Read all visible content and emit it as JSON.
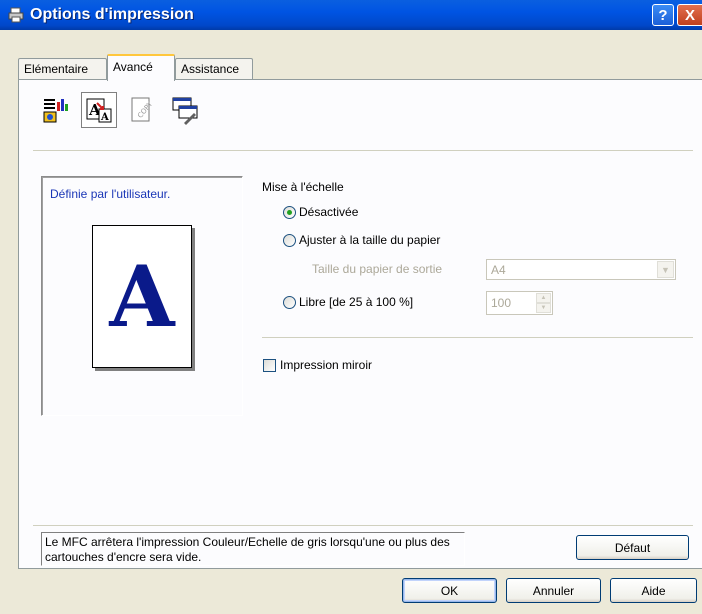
{
  "window": {
    "title": "Options d'impression",
    "help_btn": "?",
    "close_btn": "X"
  },
  "tabs": [
    {
      "label": "Elémentaire",
      "selected": false
    },
    {
      "label": "Avancé",
      "selected": true
    },
    {
      "label": "Assistance",
      "selected": false
    }
  ],
  "toolbar": {
    "icons": [
      "print-quality-icon",
      "scaling-icon",
      "watermark-copy-icon",
      "device-options-icon"
    ],
    "selected": "scaling-icon"
  },
  "preview": {
    "label": "Définie par l'utilisateur.",
    "letter": "A"
  },
  "scaling": {
    "group_label": "Mise à l'échelle",
    "option_off": "Désactivée",
    "option_fit": "Ajuster à la taille du papier",
    "output_paper_label": "Taille du papier de sortie",
    "output_paper_value": "A4",
    "option_free": "Libre [de 25 à 100 %]",
    "free_value": "100",
    "selected": "option_off"
  },
  "mirror": {
    "label": "Impression miroir",
    "checked": false
  },
  "info_text": "Le MFC arrêtera l'impression Couleur/Echelle de gris lorsqu'une ou plus des cartouches d'encre sera vide.",
  "buttons": {
    "default": "Défaut",
    "ok": "OK",
    "cancel": "Annuler",
    "help": "Aide"
  },
  "colors": {
    "titlebar": "#0054e3",
    "accent_blue_text": "#1a36b6",
    "window_bg": "#ece9d8"
  }
}
